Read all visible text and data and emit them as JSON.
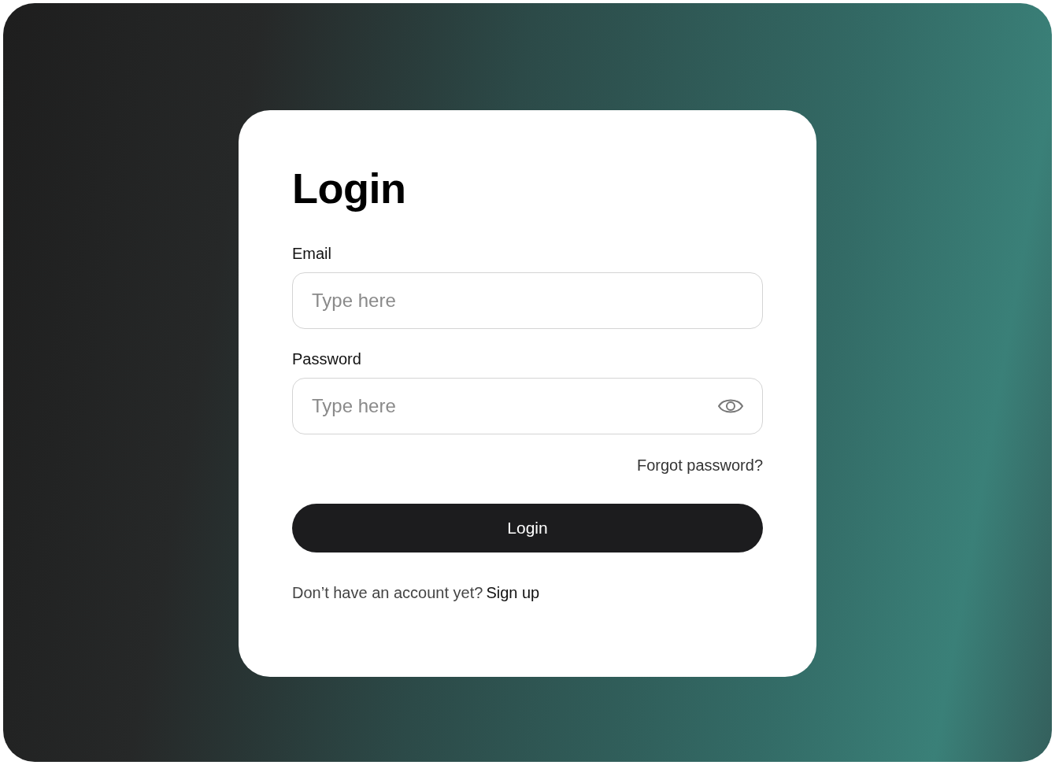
{
  "title": "Login",
  "fields": [
    {
      "label": "Email",
      "placeholder": "Type here",
      "kind": "text"
    },
    {
      "label": "Password",
      "placeholder": "Type here",
      "kind": "password"
    }
  ],
  "forgot_link": "Forgot password?",
  "submit_button": "Login",
  "footer": {
    "text": "Don’t have an account yet?",
    "link": "Sign up"
  }
}
